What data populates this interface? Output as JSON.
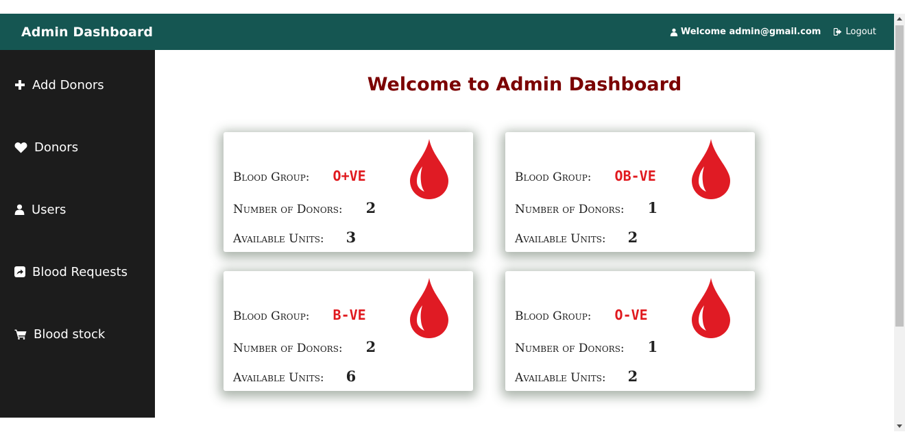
{
  "navbar": {
    "brand": "Admin Dashboard",
    "welcome": "Welcome admin@gmail.com",
    "logout": "Logout"
  },
  "sidebar": {
    "items": [
      {
        "label": "Add Donors",
        "icon": "plus-icon"
      },
      {
        "label": "Donors",
        "icon": "heart-icon"
      },
      {
        "label": "Users",
        "icon": "user-icon"
      },
      {
        "label": "Blood Requests",
        "icon": "share-square-icon"
      },
      {
        "label": "Blood stock",
        "icon": "shopping-cart-icon"
      }
    ]
  },
  "main": {
    "title": "Welcome to Admin Dashboard",
    "labels": {
      "blood_group": "Blood Group:",
      "donors": "Number of Donors:",
      "units": "Available Units:"
    },
    "cards": [
      {
        "group": "O+VE",
        "donors": "2",
        "units": "3"
      },
      {
        "group": "OB-VE",
        "donors": "1",
        "units": "2"
      },
      {
        "group": "B-VE",
        "donors": "2",
        "units": "6"
      },
      {
        "group": "O-VE",
        "donors": "1",
        "units": "2"
      }
    ]
  },
  "colors": {
    "navbar": "#155652",
    "sidebar": "#1c1c1c",
    "title": "#7b0000",
    "blood_group": "#e0191e",
    "drop": "#e01b24"
  }
}
